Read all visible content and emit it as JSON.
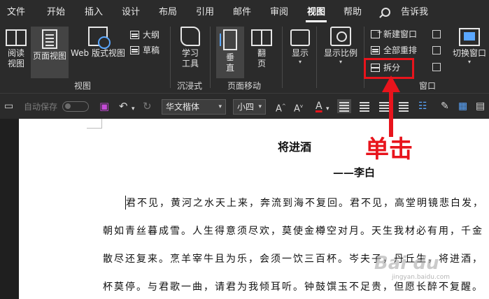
{
  "menu": {
    "tabs": [
      {
        "label": "文件"
      },
      {
        "label": "开始"
      },
      {
        "label": "插入"
      },
      {
        "label": "设计"
      },
      {
        "label": "布局"
      },
      {
        "label": "引用"
      },
      {
        "label": "邮件"
      },
      {
        "label": "审阅"
      },
      {
        "label": "视图",
        "active": true
      },
      {
        "label": "帮助"
      }
    ],
    "tell_me": "告诉我"
  },
  "ribbon": {
    "views": {
      "read_mode": "阅读\n视图",
      "print_layout": "页面视图",
      "web_layout": "Web 版式视图",
      "outline": "大纲",
      "draft": "草稿",
      "label": "视图"
    },
    "immersive": {
      "learning_tools": "学习\n工具",
      "label": "沉浸式"
    },
    "page_movement": {
      "vertical": "垂\n直",
      "side_to_side": "翻\n页",
      "label": "页面移动"
    },
    "show": {
      "label": "显示"
    },
    "zoom": {
      "label": "显示比例"
    },
    "window": {
      "new_window": "新建窗口",
      "arrange_all": "全部重排",
      "split": "拆分",
      "switch_windows": "切换窗口",
      "label": "窗口"
    }
  },
  "quick_access": {
    "autosave": "自动保存",
    "font_name": "华文楷体",
    "font_size": "小四"
  },
  "document": {
    "title": "将进酒",
    "author": "——李白",
    "lines": [
      "君不见，黄河之水天上来，奔流到海不复回。君不见，高堂明镜悲白发，",
      "朝如青丝暮成雪。人生得意须尽欢，莫使金樽空对月。天生我材必有用，千金",
      "散尽还复来。烹羊宰牛且为乐，会须一饮三百杯。岑夫子，丹丘生，将进酒，",
      "杯莫停。与君歌一曲，请君为我倾耳听。钟鼓馔玉不足贵，但愿长醉不复醒。"
    ]
  },
  "annotation": {
    "label": "单击",
    "color": "#e8141c"
  },
  "watermark": {
    "text": "Bai du",
    "sub": "jingyan.baidu.com"
  },
  "colors": {
    "ribbon_bg": "#2b2b2b",
    "accent": "#e8141c",
    "page_bg": "#ffffff"
  }
}
